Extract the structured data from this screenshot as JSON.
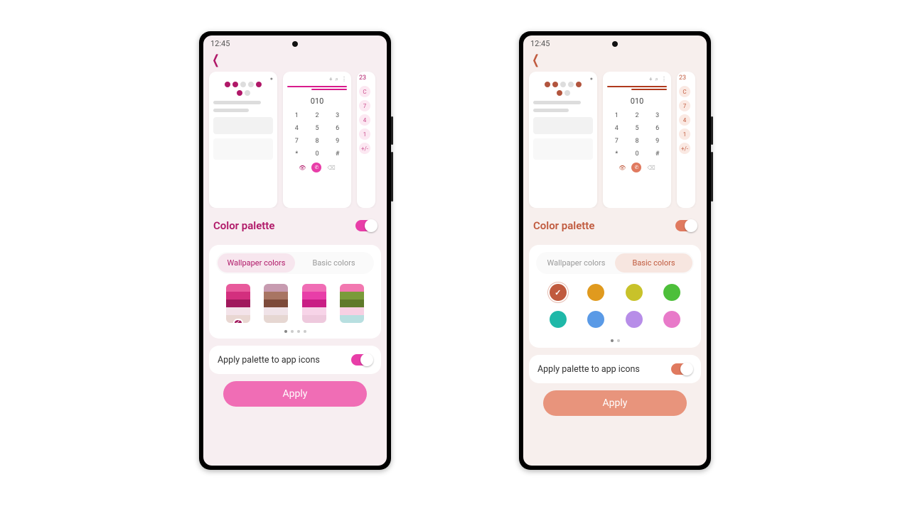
{
  "status_time": "12:45",
  "section_title": "Color palette",
  "tabs": {
    "wallpaper": "Wallpaper colors",
    "basic": "Basic colors"
  },
  "apply_icons_label": "Apply palette to app icons",
  "apply_btn": "Apply",
  "keypad": {
    "display": "010",
    "keys": [
      "1",
      "2",
      "3",
      "4",
      "5",
      "6",
      "7",
      "8",
      "9",
      "*",
      "0",
      "#"
    ]
  },
  "calc": {
    "head": "23",
    "keys": [
      "C",
      "7",
      "4",
      "1",
      "+/-"
    ]
  },
  "left": {
    "active_tab": "wallpaper",
    "palettes": [
      {
        "colors": [
          "#e85a9c",
          "#d32f7e",
          "#a0185c",
          "#f3e3e9",
          "#e9d7d2"
        ],
        "selected": true
      },
      {
        "colors": [
          "#c79bb0",
          "#a87563",
          "#7d4a3a",
          "#f0e3e8",
          "#e6d7d2"
        ],
        "selected": false
      },
      {
        "colors": [
          "#f06db5",
          "#e83ea8",
          "#c91e85",
          "#f7d4e8",
          "#eec9dd"
        ],
        "selected": false
      },
      {
        "colors": [
          "#f278b0",
          "#7a9b3a",
          "#5f7a2a",
          "#f7d0e3",
          "#b8dfe0"
        ],
        "selected": false
      }
    ],
    "page_dots": 4,
    "active_dot": 0
  },
  "right": {
    "active_tab": "basic",
    "basic_colors": [
      {
        "hex": "#c05a3e",
        "selected": true
      },
      {
        "hex": "#e09a1e",
        "selected": false
      },
      {
        "hex": "#c8c22a",
        "selected": false
      },
      {
        "hex": "#4dbf3a",
        "selected": false
      },
      {
        "hex": "#1fb8a8",
        "selected": false
      },
      {
        "hex": "#5a9ae6",
        "selected": false
      },
      {
        "hex": "#b78de8",
        "selected": false
      },
      {
        "hex": "#e87ac9",
        "selected": false
      }
    ],
    "page_dots": 2,
    "active_dot": 0
  }
}
